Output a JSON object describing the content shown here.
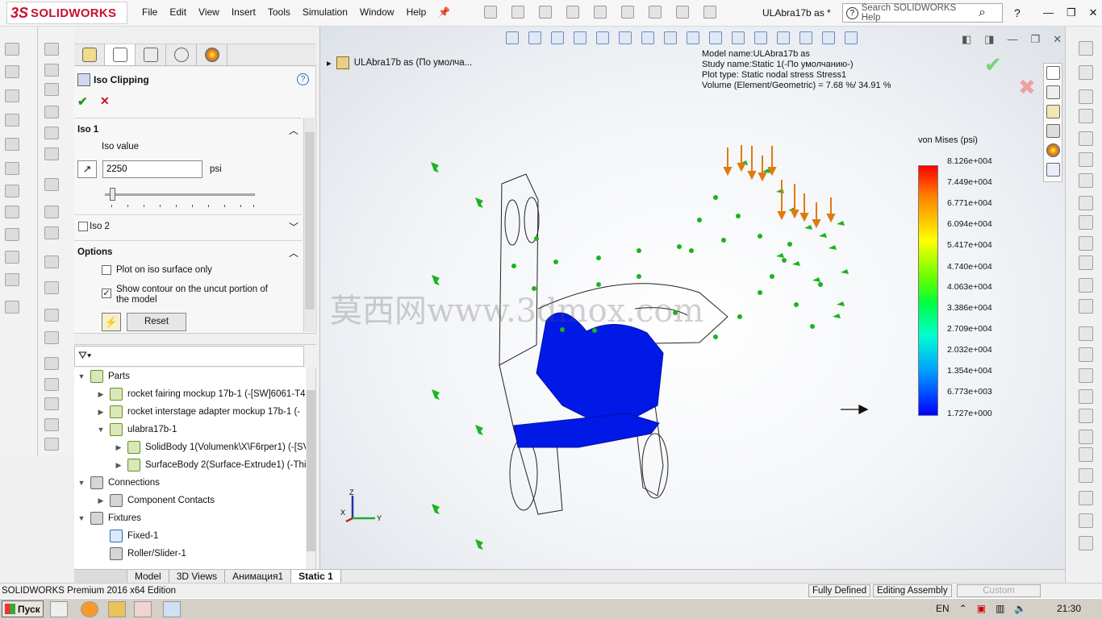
{
  "app": {
    "logo_prefix": "3S",
    "logo_text": "SOLIDWORKS",
    "document_title": "ULAbra17b as *",
    "search_placeholder": "Search SOLIDWORKS Help",
    "help_label": "?"
  },
  "menu": [
    "File",
    "Edit",
    "View",
    "Insert",
    "Tools",
    "Simulation",
    "Window",
    "Help"
  ],
  "property_manager": {
    "title": "Iso Clipping",
    "iso1": {
      "header": "Iso 1",
      "iso_value_label": "Iso value",
      "iso_value": "2250",
      "unit": "psi",
      "slider_fraction": 0.04
    },
    "iso2": {
      "header": "Iso 2",
      "checked": false
    },
    "options": {
      "header": "Options",
      "plot_on_iso_surface_only": {
        "label": "Plot on iso surface only",
        "checked": false
      },
      "show_contour": {
        "label_line1": "Show contour on the uncut portion of",
        "label_line2": "the model",
        "checked": true
      },
      "reset_label": "Reset"
    }
  },
  "tree": {
    "items": [
      {
        "label": "Parts",
        "expand": "▼",
        "level": 0
      },
      {
        "label": "rocket fairing mockup 17b-1 (-[SW]6061-T4",
        "expand": "▶",
        "level": 1
      },
      {
        "label": "rocket interstage adapter mockup 17b-1 (-",
        "expand": "▶",
        "level": 1
      },
      {
        "label": "ulabra17b-1",
        "expand": "▼",
        "level": 1
      },
      {
        "label": "SolidBody 1(Volumenk\\X\\F6rper1) (-[SV",
        "expand": "▶",
        "level": 2
      },
      {
        "label": "SurfaceBody 2(Surface-Extrude1) (-Thic",
        "expand": "▶",
        "level": 2
      },
      {
        "label": "Connections",
        "expand": "▼",
        "level": 0
      },
      {
        "label": "Component Contacts",
        "expand": "▶",
        "level": 1
      },
      {
        "label": "Fixtures",
        "expand": "▼",
        "level": 0
      },
      {
        "label": "Fixed-1",
        "expand": "",
        "level": 1
      },
      {
        "label": "Roller/Slider-1",
        "expand": "",
        "level": 1
      }
    ]
  },
  "bottom_tabs": [
    "Model",
    "3D Views",
    "Анимация1",
    "Static 1"
  ],
  "status": {
    "edition": "SOLIDWORKS Premium 2016 x64 Edition",
    "defined": "Fully Defined",
    "editing": "Editing Assembly",
    "custom": "Custom"
  },
  "taskbar": {
    "start": "Пуск",
    "lang": "EN",
    "clock": "21:30"
  },
  "viewport": {
    "tree_root": "ULAbra17b as  (По умолча...",
    "info": [
      "Model name:ULAbra17b as",
      "Study name:Static 1(-По умолчанию-)",
      "Plot type: Static nodal stress Stress1",
      "Volume (Element/Geometric) = 7.68 %/ 34.91 %"
    ],
    "legend_title": "von Mises (psi)",
    "legend_values": [
      "8.126e+004",
      "7.449e+004",
      "6.771e+004",
      "6.094e+004",
      "5.417e+004",
      "4.740e+004",
      "4.063e+004",
      "3.386e+004",
      "2.709e+004",
      "2.032e+004",
      "1.354e+004",
      "6.773e+003",
      "1.727e+000"
    ],
    "watermark": "莫西网www.3dmox.com",
    "triad": {
      "z": "Z",
      "y": "Y",
      "x": "X"
    }
  },
  "colors": {
    "accent": "#c8102e",
    "ok": "#1e9a1e",
    "mesh_blue": "#0019e6",
    "fixture_green": "#1db31d",
    "load_orange": "#e07a10"
  }
}
